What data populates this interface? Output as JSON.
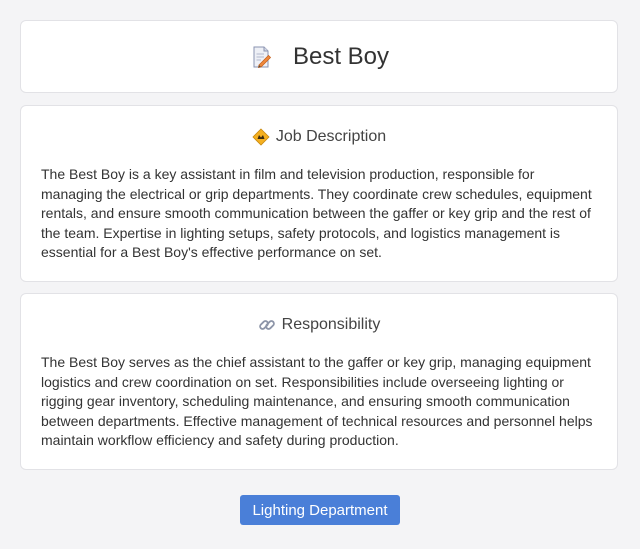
{
  "page": {
    "title": "Best Boy",
    "title_icon": "memo-pencil-icon"
  },
  "job_description": {
    "icon": "construction-diamond-icon",
    "heading": "Job Description",
    "text": "The Best Boy is a key assistant in film and television production, responsible for managing the electrical or grip departments. They coordinate crew schedules, equipment rentals, and ensure smooth communication between the gaffer or key grip and the rest of the team. Expertise in lighting setups, safety protocols, and logistics management is essential for a Best Boy's effective performance on set."
  },
  "responsibility": {
    "icon": "link-icon",
    "heading": "Responsibility",
    "text": "The Best Boy serves as the chief assistant to the gaffer or key grip, managing equipment logistics and crew coordination on set. Responsibilities include overseeing lighting or rigging gear inventory, scheduling maintenance, and ensuring smooth communication between departments. Effective management of technical resources and personnel helps maintain workflow efficiency and safety during production."
  },
  "button": {
    "label": "Lighting Department"
  },
  "colors": {
    "accent": "#4a7fd8",
    "background": "#f4f4f6",
    "card": "#ffffff"
  }
}
